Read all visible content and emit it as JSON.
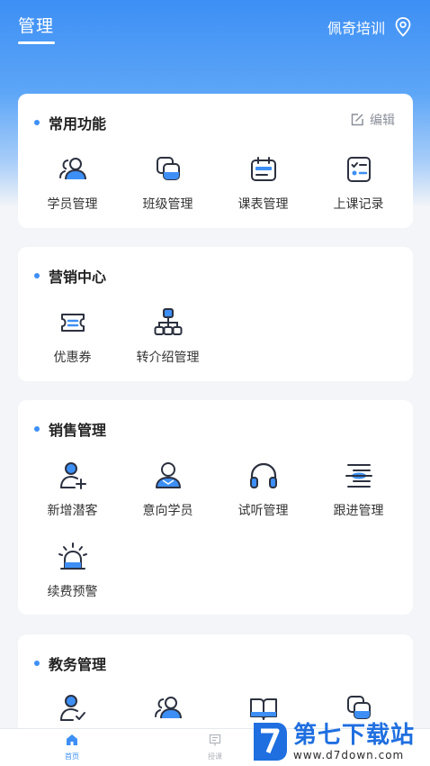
{
  "header": {
    "tab_label": "管理",
    "org_name": "佩奇培训",
    "location_icon": "location-pin-icon"
  },
  "colors": {
    "accent": "#3d8ff5",
    "icon_dark": "#2c3140"
  },
  "sections": {
    "common": {
      "title": "常用功能",
      "edit_label": "编辑",
      "items": [
        {
          "label": "学员管理",
          "icon": "students-icon"
        },
        {
          "label": "班级管理",
          "icon": "class-icon"
        },
        {
          "label": "课表管理",
          "icon": "schedule-icon"
        },
        {
          "label": "上课记录",
          "icon": "attendance-record-icon"
        }
      ]
    },
    "marketing": {
      "title": "营销中心",
      "items": [
        {
          "label": "优惠券",
          "icon": "coupon-icon"
        },
        {
          "label": "转介绍管理",
          "icon": "referral-icon"
        }
      ]
    },
    "sales": {
      "title": "销售管理",
      "items": [
        {
          "label": "新增潜客",
          "icon": "add-prospect-icon"
        },
        {
          "label": "意向学员",
          "icon": "intended-student-icon"
        },
        {
          "label": "试听管理",
          "icon": "headphones-icon"
        },
        {
          "label": "跟进管理",
          "icon": "follow-up-icon"
        },
        {
          "label": "续费预警",
          "icon": "alarm-icon"
        }
      ]
    },
    "academic": {
      "title": "教务管理"
    }
  },
  "bottom_nav": {
    "home_label": "首页",
    "teach_label": "授课"
  },
  "watermark": {
    "title": "第七下载站",
    "url": "www.d7down.com"
  }
}
